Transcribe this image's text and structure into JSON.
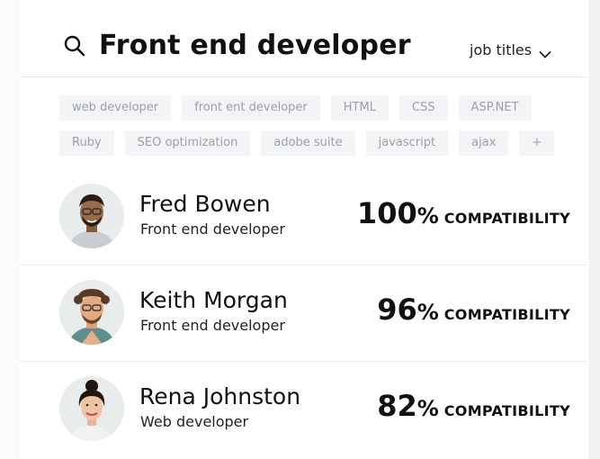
{
  "search": {
    "query": "Front end developer",
    "filter_label": "job titles"
  },
  "tags": {
    "row1": [
      "web developer",
      "front ent developer",
      "HTML",
      "CSS",
      "ASP.NET"
    ],
    "row2": [
      "Ruby",
      "SEO optimization",
      "adobe suite",
      "javascript",
      "ajax",
      "+"
    ]
  },
  "candidates": [
    {
      "name": "Fred Bowen",
      "title": "Front end developer",
      "score": "100",
      "percent_sign": "%",
      "label": "COMPATIBILITY"
    },
    {
      "name": "Keith Morgan",
      "title": "Front end developer",
      "score": "96",
      "percent_sign": "%",
      "label": "COMPATIBILITY"
    },
    {
      "name": "Rena Johnston",
      "title": "Web developer",
      "score": "82",
      "percent_sign": "%",
      "label": "COMPATIBILITY"
    }
  ],
  "icons": {
    "search": "search-icon",
    "chevron": "chevron-down-icon"
  },
  "colors": {
    "tag_bg": "#f3f4f6",
    "tag_text": "#9aa0a6",
    "text": "#111111"
  }
}
